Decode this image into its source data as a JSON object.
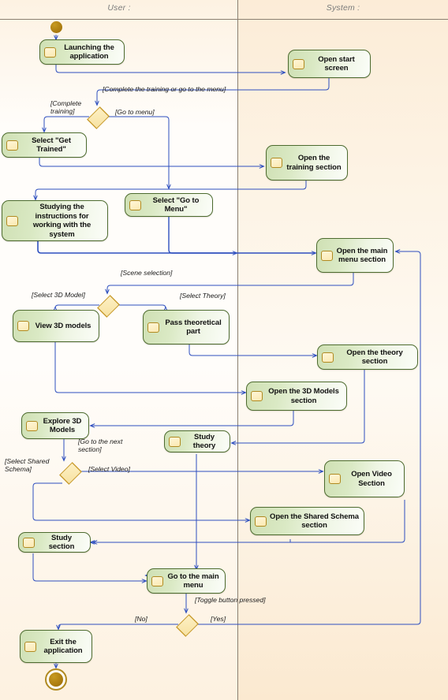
{
  "diagram": {
    "type": "uml-activity-diagram",
    "lanes": [
      {
        "id": "user",
        "title": "User :"
      },
      {
        "id": "system",
        "title": "System :"
      }
    ],
    "colors": {
      "node_border": "#4d6b2f",
      "node_fill_start": "#cfe0b4",
      "node_fill_end": "#fbfdf8",
      "decision_border": "#c89a2a",
      "decision_fill": "#f7e2a2",
      "edge": "#2e4fbf",
      "initial_final_node": "#a8780d",
      "lane_divider": "#8a8071",
      "background_user": "#fffdfa",
      "background_system": "#fdf3e4"
    },
    "nodes": [
      {
        "id": "start",
        "kind": "initial",
        "lane": "user"
      },
      {
        "id": "launch",
        "kind": "action",
        "lane": "user",
        "label": "Launching the application"
      },
      {
        "id": "open-start",
        "kind": "action",
        "lane": "system",
        "label": "Open start screen"
      },
      {
        "id": "d1",
        "kind": "decision",
        "lane": "user"
      },
      {
        "id": "get-trained",
        "kind": "action",
        "lane": "user",
        "label": "Select \"Get Trained\""
      },
      {
        "id": "open-training",
        "kind": "action",
        "lane": "system",
        "label": "Open the training section"
      },
      {
        "id": "studying",
        "kind": "action",
        "lane": "user",
        "label": "Studying the instructions for working with the system"
      },
      {
        "id": "go-to-menu",
        "kind": "action",
        "lane": "user",
        "label": "Select \"Go to Menu\""
      },
      {
        "id": "open-main",
        "kind": "action",
        "lane": "system",
        "label": "Open the main menu section"
      },
      {
        "id": "d2",
        "kind": "decision",
        "lane": "user"
      },
      {
        "id": "view-3d",
        "kind": "action",
        "lane": "user",
        "label": "View 3D models"
      },
      {
        "id": "pass-theory",
        "kind": "action",
        "lane": "user",
        "label": "Pass theoretical part"
      },
      {
        "id": "open-theory",
        "kind": "action",
        "lane": "system",
        "label": "Open the theory section"
      },
      {
        "id": "open-3d",
        "kind": "action",
        "lane": "system",
        "label": "Open the 3D Models section"
      },
      {
        "id": "explore-3d",
        "kind": "action",
        "lane": "user",
        "label": "Explore 3D Models"
      },
      {
        "id": "study-theory",
        "kind": "action",
        "lane": "user",
        "label": "Study theory"
      },
      {
        "id": "d3",
        "kind": "decision",
        "lane": "user"
      },
      {
        "id": "open-video",
        "kind": "action",
        "lane": "system",
        "label": "Open Video Section"
      },
      {
        "id": "open-shared",
        "kind": "action",
        "lane": "system",
        "label": "Open the Shared Schema section"
      },
      {
        "id": "study-section",
        "kind": "action",
        "lane": "user",
        "label": "Study section"
      },
      {
        "id": "go-main-menu",
        "kind": "action",
        "lane": "user",
        "label": "Go to the main menu"
      },
      {
        "id": "d4",
        "kind": "decision",
        "lane": "user"
      },
      {
        "id": "exit-app",
        "kind": "action",
        "lane": "user",
        "label": "Exit the application"
      },
      {
        "id": "end",
        "kind": "final",
        "lane": "user"
      }
    ],
    "guards": [
      {
        "id": "g-training-or-menu",
        "text": "[Complete the training or go to the menu]"
      },
      {
        "id": "g-complete-training",
        "text": "[Complete\ntraining]"
      },
      {
        "id": "g-go-to-menu",
        "text": "[Go to menu]"
      },
      {
        "id": "g-scene-selection",
        "text": "[Scene selection]"
      },
      {
        "id": "g-select-3d-model",
        "text": "[Select 3D Model]"
      },
      {
        "id": "g-select-theory",
        "text": "[Select Theory]"
      },
      {
        "id": "g-next-section",
        "text": "[Go to the next\nsection]"
      },
      {
        "id": "g-select-shared",
        "text": "[Select Shared\nSchema]"
      },
      {
        "id": "g-select-video",
        "text": "[Select Video]"
      },
      {
        "id": "g-toggle-pressed",
        "text": "[Toggle button pressed]"
      },
      {
        "id": "g-no",
        "text": "[No]"
      },
      {
        "id": "g-yes",
        "text": "[Yes]"
      }
    ]
  }
}
